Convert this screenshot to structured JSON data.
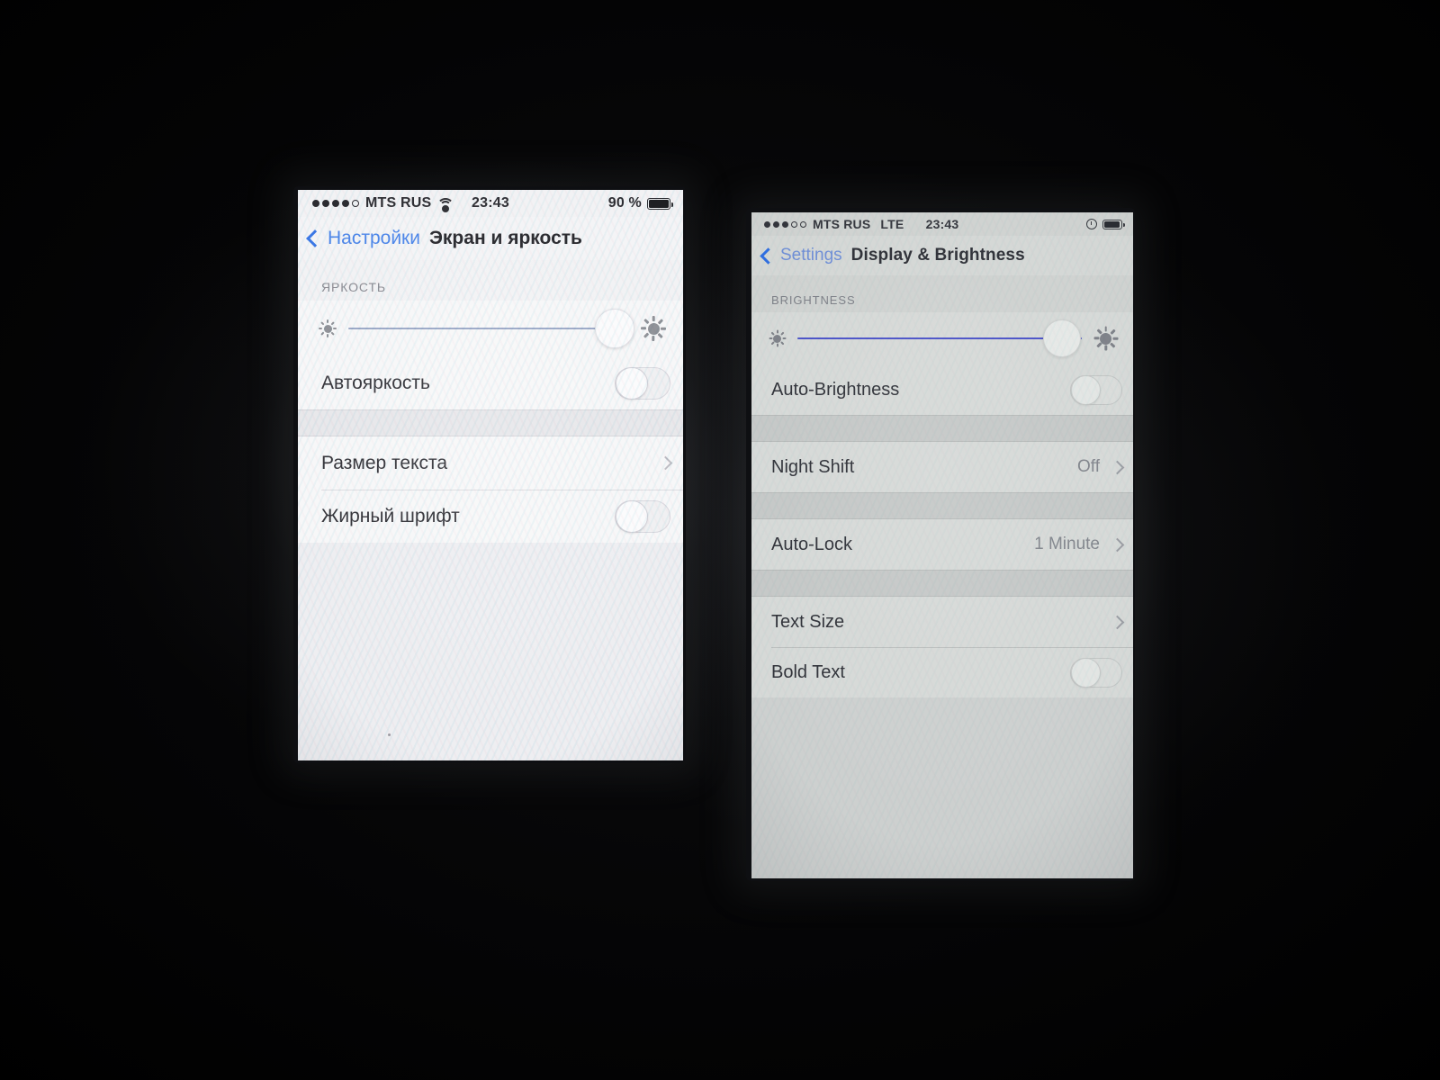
{
  "scene": {
    "description": "Two iPhones photographed side by side in a dark room, both showing the iOS Display & Brightness settings screen, left in Russian and right in English"
  },
  "phone_left": {
    "status_bar": {
      "signal_dots_filled": 4,
      "signal_dots_total": 5,
      "carrier": "MTS RUS",
      "wifi_icon": "wifi-icon",
      "time": "23:43",
      "battery_percent": "90 %",
      "battery_level": 90
    },
    "nav": {
      "back_label": "Настройки",
      "back_icon": "chevron-left-icon",
      "title": "Экран и яркость"
    },
    "sections": [
      {
        "header": "ЯРКОСТЬ",
        "rows": [
          {
            "type": "slider",
            "name": "brightness-slider",
            "value_percent": 95,
            "low_icon": "sun-small-icon",
            "high_icon": "sun-large-icon"
          },
          {
            "type": "toggle",
            "label": "Автояркость",
            "name": "auto-brightness-toggle",
            "state": "off"
          }
        ]
      },
      {
        "header": "",
        "rows": [
          {
            "type": "disclosure",
            "label": "Размер текста",
            "name": "text-size-row",
            "value": ""
          },
          {
            "type": "toggle",
            "label": "Жирный шрифт",
            "name": "bold-text-toggle",
            "state": "off"
          }
        ]
      }
    ]
  },
  "phone_right": {
    "status_bar": {
      "signal_dots_filled": 3,
      "signal_dots_total": 5,
      "carrier": "MTS RUS",
      "network": "LTE",
      "time": "23:43",
      "alarm_icon": "alarm-clock-icon",
      "battery_level": 85
    },
    "nav": {
      "back_label": "Settings",
      "back_icon": "chevron-left-icon",
      "title": "Display & Brightness"
    },
    "sections": [
      {
        "header": "BRIGHTNESS",
        "rows": [
          {
            "type": "slider",
            "name": "brightness-slider",
            "value_percent": 93,
            "low_icon": "sun-small-icon",
            "high_icon": "sun-large-icon"
          },
          {
            "type": "toggle",
            "label": "Auto-Brightness",
            "name": "auto-brightness-toggle",
            "state": "off"
          }
        ]
      },
      {
        "header": "",
        "rows": [
          {
            "type": "disclosure",
            "label": "Night Shift",
            "name": "night-shift-row",
            "value": "Off"
          }
        ]
      },
      {
        "header": "",
        "rows": [
          {
            "type": "disclosure",
            "label": "Auto-Lock",
            "name": "auto-lock-row",
            "value": "1 Minute"
          }
        ]
      },
      {
        "header": "",
        "rows": [
          {
            "type": "disclosure",
            "label": "Text Size",
            "name": "text-size-row",
            "value": ""
          },
          {
            "type": "toggle",
            "label": "Bold Text",
            "name": "bold-text-toggle",
            "state": "off"
          }
        ]
      }
    ]
  },
  "colors": {
    "accent_blue": "#4a85ea",
    "slider_blue": "#4a52c8",
    "left_screen_bg": "#f2f2f4",
    "right_screen_bg": "#cfd2d0",
    "backdrop": "#000000"
  }
}
